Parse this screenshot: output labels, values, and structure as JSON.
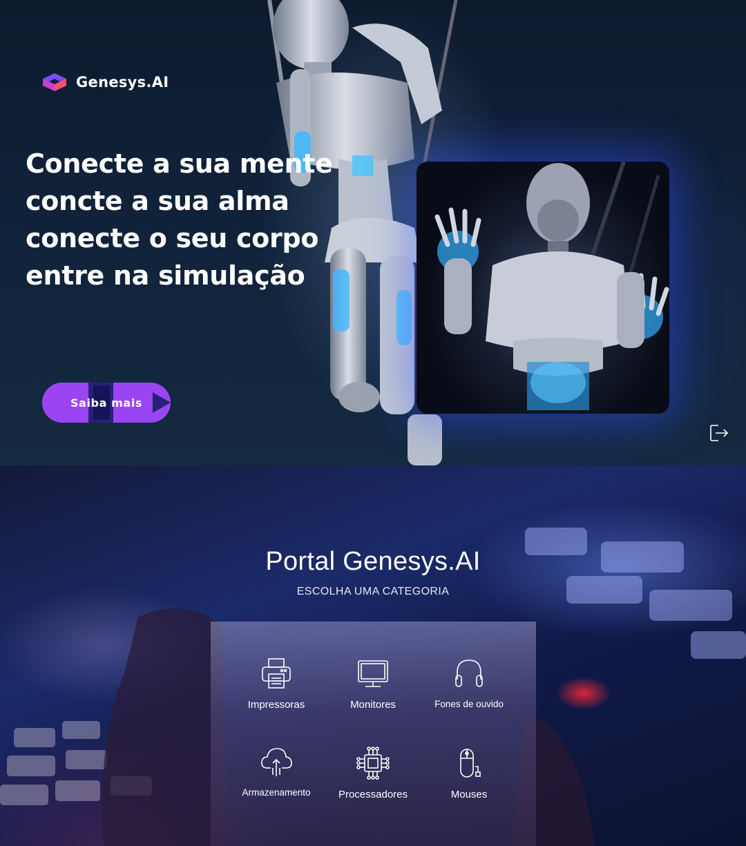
{
  "brand": {
    "name": "Genesys.AI"
  },
  "hero": {
    "headline": [
      "Conecte a sua mente",
      "concte a sua alma",
      "conecte o seu corpo",
      "entre na simulação"
    ],
    "cta_label": "Saiba mais"
  },
  "portal": {
    "title": "Portal Genesys.AI",
    "subtitle": "ESCOLHA UMA CATEGORIA",
    "categories": [
      {
        "label": "Impressoras",
        "icon": "printer-icon"
      },
      {
        "label": "Monitores",
        "icon": "monitor-icon"
      },
      {
        "label": "Fones de ouvido",
        "icon": "headphones-icon"
      },
      {
        "label": "Armazenamento",
        "icon": "cloud-storage-icon"
      },
      {
        "label": "Processadores",
        "icon": "cpu-icon"
      },
      {
        "label": "Mouses",
        "icon": "mouse-icon"
      }
    ]
  },
  "colors": {
    "accent": "#9b45f2",
    "accent_dark": "#2a1f7a",
    "glow": "#3a5cff"
  }
}
